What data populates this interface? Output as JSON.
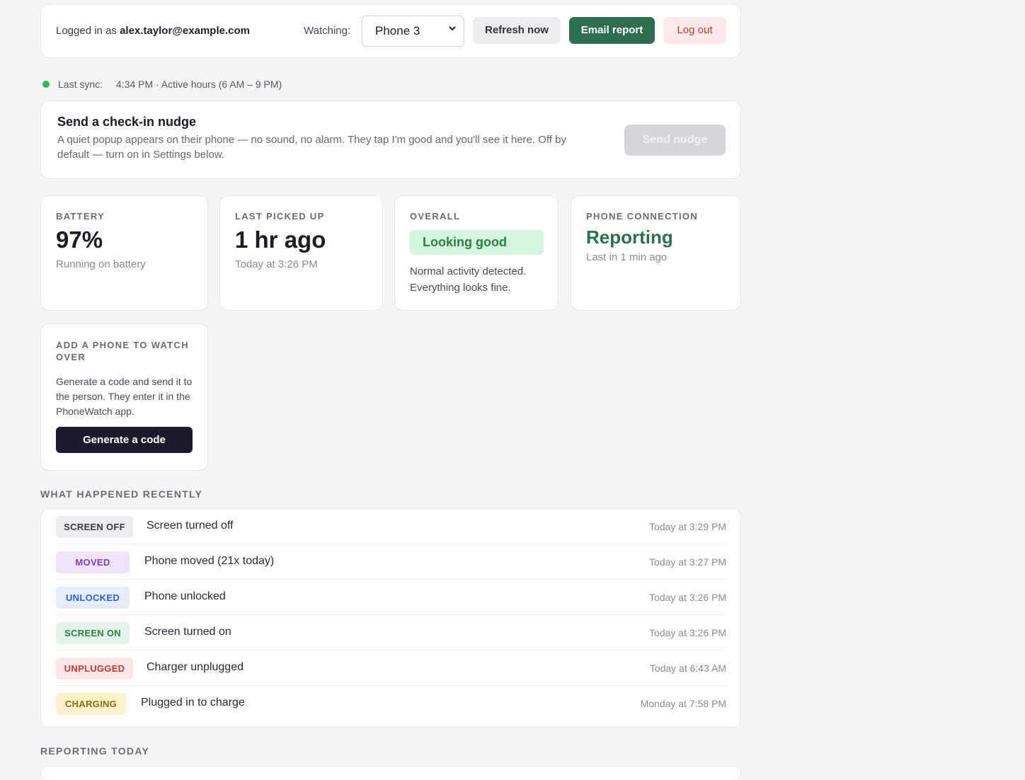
{
  "header": {
    "logged_in_prefix": "Logged in as",
    "user_email": "alex.taylor@example.com",
    "watching_label": "Watching:",
    "selected_phone": "Phone 3",
    "refresh_label": "Refresh now",
    "email_label": "Email report",
    "logout_label": "Log out"
  },
  "sync": {
    "label": "Last sync:",
    "value": "4:34 PM · Active hours (6 AM – 9 PM)",
    "status_color": "#2fb85a"
  },
  "nudge": {
    "title": "Send a check-in nudge",
    "description": "A quiet popup appears on their phone — no sound, no alarm. They tap I'm good and you'll see it here. Off by default — turn on in Settings below.",
    "button_label": "Send nudge",
    "button_enabled": false
  },
  "stats": {
    "battery": {
      "label": "BATTERY",
      "value": "97%",
      "sub": "Running on battery"
    },
    "last_picked_up": {
      "label": "LAST PICKED UP",
      "value": "1 hr ago",
      "sub": "Today at 3:26 PM"
    },
    "overall": {
      "label": "OVERALL",
      "status": "Looking good",
      "description": "Normal activity detected. Everything looks fine."
    },
    "phone_connection": {
      "label": "PHONE CONNECTION",
      "value": "Reporting",
      "sub": "Last in 1 min ago"
    }
  },
  "add_phone": {
    "title": "ADD A PHONE TO WATCH OVER",
    "description": "Generate a code and send it to the person. They enter it in the PhoneWatch app.",
    "button_label": "Generate a code"
  },
  "recent": {
    "heading": "WHAT HAPPENED RECENTLY",
    "events": [
      {
        "badge": "SCREEN OFF",
        "text": "Screen turned off",
        "time": "Today at 3:29 PM",
        "badge_bg": "#ededf0",
        "badge_fg": "#3a3a44"
      },
      {
        "badge": "MOVED",
        "text": "Phone moved (21x today)",
        "time": "Today at 3:27 PM",
        "badge_bg": "#f1e2fb",
        "badge_fg": "#7e3fb0"
      },
      {
        "badge": "UNLOCKED",
        "text": "Phone unlocked",
        "time": "Today at 3:26 PM",
        "badge_bg": "#e3edfd",
        "badge_fg": "#2a62c9"
      },
      {
        "badge": "SCREEN ON",
        "text": "Screen turned on",
        "time": "Today at 3:26 PM",
        "badge_bg": "#e2f4e7",
        "badge_fg": "#2e7d47"
      },
      {
        "badge": "UNPLUGGED",
        "text": "Charger unplugged",
        "time": "Today at 6:43 AM",
        "badge_bg": "#fde6e7",
        "badge_fg": "#c0392b"
      },
      {
        "badge": "CHARGING",
        "text": "Plugged in to charge",
        "time": "Monday at 7:58 PM",
        "badge_bg": "#fdf2c8",
        "badge_fg": "#8a6a10"
      }
    ]
  },
  "reporting": {
    "heading": "REPORTING TODAY"
  }
}
